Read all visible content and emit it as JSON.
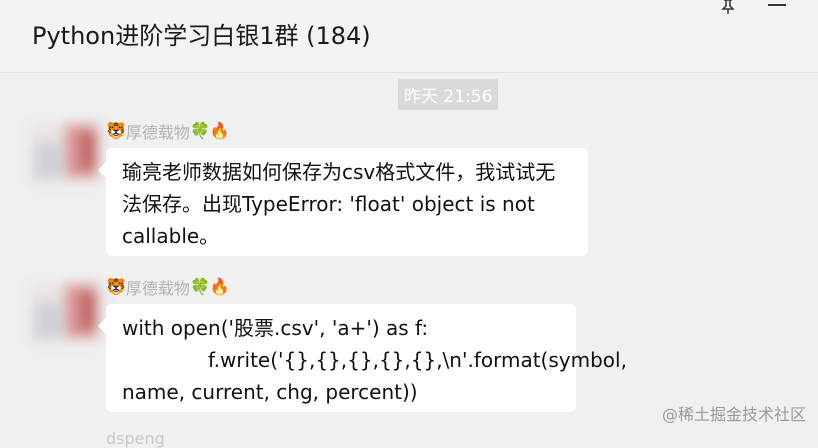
{
  "header": {
    "title": "Python进阶学习白银1群 (184)"
  },
  "icons": {
    "pin": "pin-icon",
    "minimize": "minimize-icon"
  },
  "chat": {
    "timestamp": "昨天 21:56",
    "messages": [
      {
        "sender": "厚德载物",
        "sender_emoji_before": "🐯",
        "sender_emoji_after": [
          "🍀",
          "🔥"
        ],
        "lines": [
          "瑜亮老师数据如何保存为csv格式文件，我试试无",
          "法保存。出现TypeError: 'float' object is not",
          "callable。"
        ]
      },
      {
        "sender": "厚德载物",
        "sender_emoji_before": "🐯",
        "sender_emoji_after": [
          "🍀",
          "🔥"
        ],
        "lines": [
          "with open('股票.csv', 'a+') as f:",
          "f.write('{},{},{},{},{},\\n'.format(symbol,",
          "name, current, chg, percent))"
        ]
      }
    ],
    "next_sender_partial": "dspeng"
  },
  "watermark": "@稀土掘金技术社区",
  "colors": {
    "background": "#f0f0f0",
    "bubble": "#ffffff",
    "timestamp_bg": "#dadada",
    "sender_name": "#b4b4b4"
  }
}
